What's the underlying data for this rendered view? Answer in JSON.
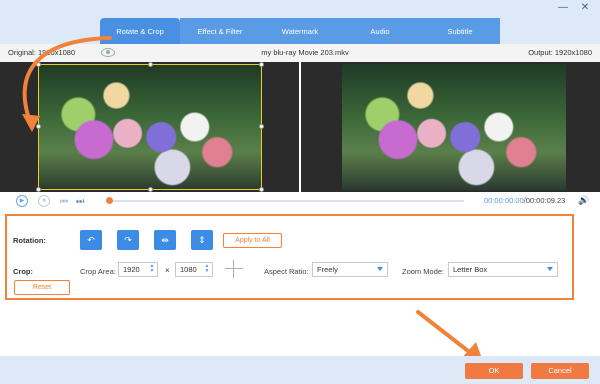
{
  "window": {
    "minimize": "—",
    "close": "✕"
  },
  "tabs": [
    {
      "label": "Rotate & Crop",
      "active": true
    },
    {
      "label": "Effect & Filter",
      "active": false
    },
    {
      "label": "Watermark",
      "active": false
    },
    {
      "label": "Audio",
      "active": false
    },
    {
      "label": "Subtitle",
      "active": false
    }
  ],
  "info": {
    "original": "Original: 1920x1080",
    "filename": "my blu-ray Movie 203.mkv",
    "output": "Output: 1920x1080"
  },
  "player": {
    "current_time": "00:00:00.00",
    "separator": "/",
    "duration": "00:00:09.23",
    "progress": 0.0
  },
  "rotation": {
    "label": "Rotation:",
    "apply_all": "Apply to All"
  },
  "crop": {
    "label": "Crop:",
    "area_label": "Crop Area:",
    "width": "1920",
    "times": "×",
    "height": "1080",
    "aspect_label": "Aspect Ratio:",
    "aspect_value": "Freely",
    "zoom_label": "Zoom Mode:",
    "zoom_value": "Letter Box",
    "reset": "Reset"
  },
  "footer": {
    "ok": "OK",
    "cancel": "Cancel"
  },
  "colors": {
    "accent": "#f0823a",
    "primary": "#4a90e2"
  }
}
